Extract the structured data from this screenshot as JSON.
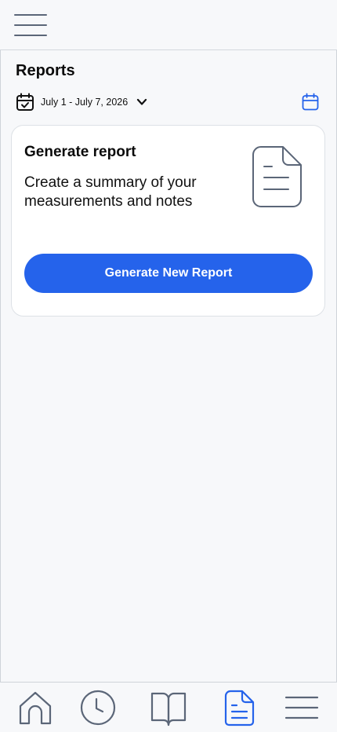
{
  "header": {
    "menu_icon": "hamburger-menu-icon"
  },
  "page": {
    "title": "Reports",
    "date_range": "July 1 - July 7, 2026",
    "date_icon": "calendar-check-icon",
    "calendar_button_icon": "calendar-icon"
  },
  "card": {
    "title": "Generate report",
    "description": "Create a summary of your measurements and notes",
    "illustration_icon": "document-icon",
    "button_label": "Generate New Report"
  },
  "bottom_nav": {
    "items": [
      {
        "icon": "home-icon",
        "active": false
      },
      {
        "icon": "clock-icon",
        "active": false
      },
      {
        "icon": "book-icon",
        "active": false
      },
      {
        "icon": "document-icon",
        "active": true
      },
      {
        "icon": "menu-icon",
        "active": false
      }
    ]
  },
  "colors": {
    "accent": "#2563eb",
    "icon_gray": "#5b6678",
    "background": "#f7f8fa",
    "card": "#ffffff"
  }
}
